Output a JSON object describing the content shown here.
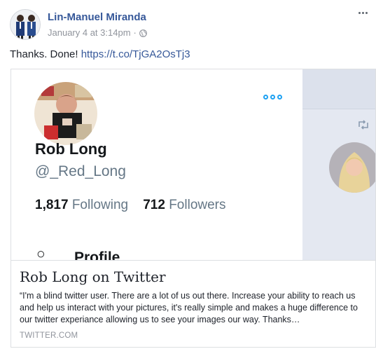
{
  "post": {
    "author": "Lin-Manuel Miranda",
    "timestamp": "January 4 at 3:14pm",
    "separator": "·",
    "text": "Thanks. Done! ",
    "link": "https://t.co/TjGA2OsTj3"
  },
  "link_preview": {
    "profile_name": "Rob Long",
    "profile_handle": "@_Red_Long",
    "following_count": "1,817",
    "following_label": "Following",
    "followers_count": "712",
    "followers_label": "Followers",
    "profile_icon": "○",
    "profile_label": "Profile",
    "title": "Rob Long on Twitter",
    "description": "“I'm a blind twitter user. There are a lot of us out there. Increase your ability to reach us and help us interact with your pictures, it's really simple and makes a huge difference to our twitter experiance allowing us to see your images our way. Thanks…",
    "domain": "TWITTER.COM"
  },
  "icons": {
    "globe": "globe-icon",
    "more": "more-options-icon",
    "retweet": "retweet-icon",
    "tw_more": "twitter-more-icon"
  },
  "colors": {
    "link": "#365899",
    "meta": "#90949c",
    "twitter_blue": "#1da1f2"
  }
}
